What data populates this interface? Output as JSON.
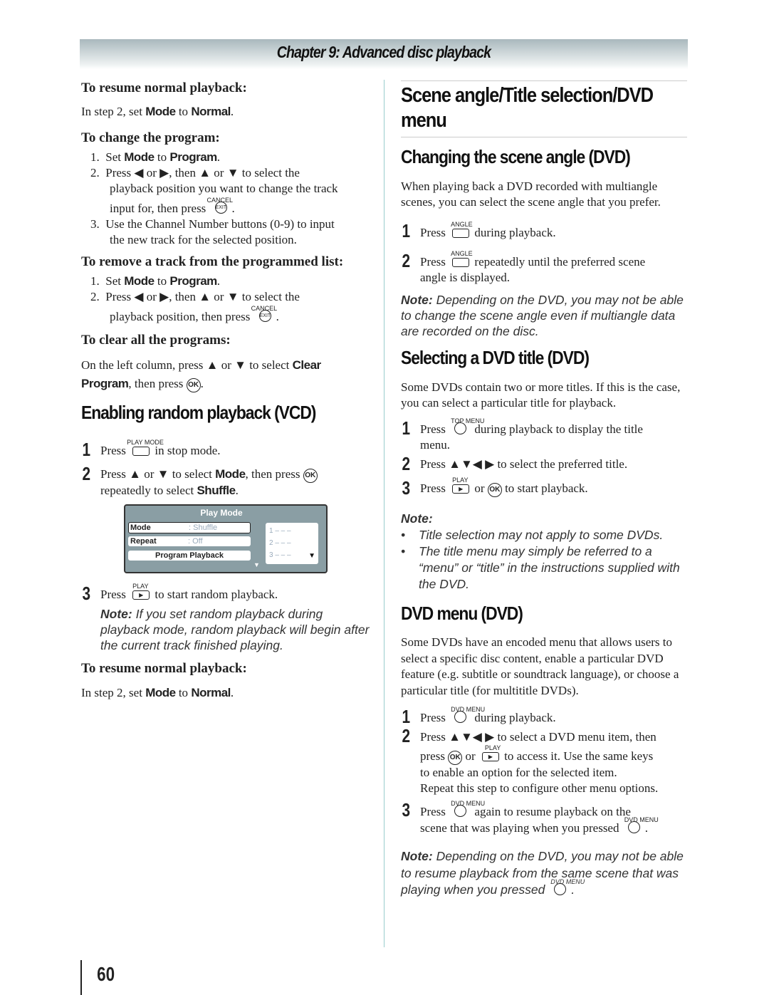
{
  "header": {
    "chapter": "Chapter 9: Advanced disc playback"
  },
  "left": {
    "resume1": {
      "title": "To resume normal playback:",
      "pre": "In step 2, set ",
      "mode": "Mode",
      "to": " to ",
      "normal": "Normal",
      "end": "."
    },
    "change": {
      "title": "To change the program:",
      "s1_pre": "Set ",
      "s1_mode": "Mode",
      "s1_to": " to ",
      "s1_prog": "Program",
      "s1_end": ".",
      "s2a": "Press ◀ or ▶, then ▲ or ▼ to select the",
      "s2b": "playback position you want to change the track",
      "s2c": "input for, then press",
      "s3a": "Use the Channel Number buttons (0-9) to input",
      "s3b": "the new track for the selected position."
    },
    "remove": {
      "title": "To remove a track from the programmed list:",
      "s1_pre": "Set ",
      "s1_mode": "Mode",
      "s1_to": " to ",
      "s1_prog": "Program",
      "s1_end": ".",
      "s2a": "Press ◀ or ▶, then ▲ or ▼ to select the",
      "s2b": "playback position, then press"
    },
    "clear": {
      "title": "To clear all the programs:",
      "a": "On the left column, press ▲ or ▼ to select ",
      "clear": "Clear",
      "prog": "Program",
      "b": ", then press"
    },
    "random": {
      "title": "Enabling random playback (VCD)",
      "step1_pre": "Press",
      "step1_post": "in stop mode.",
      "step2_pre": "Press ▲ or ▼ to select ",
      "mode": "Mode",
      "step2_mid": ", then press",
      "step2_b": "repeatedly to select ",
      "shuffle": "Shuffle",
      "step3_pre": "Press",
      "step3_post": "to start random playback.",
      "note_label": "Note:",
      "note": " If you set random playback during playback mode, random playback will begin after the current track finished playing."
    },
    "playmode": {
      "title": "Play Mode",
      "mode_label": "Mode",
      "mode_value": ": Shuffle",
      "repeat_label": "Repeat",
      "repeat_value": ": Off",
      "program_playback": "Program Playback",
      "list": [
        "1  – – –",
        "2  – – –",
        "3  – – –"
      ]
    },
    "resume2": {
      "title": "To resume normal playback:",
      "pre": "In step 2, set ",
      "mode": "Mode",
      "to": " to ",
      "normal": "Normal",
      "end": "."
    }
  },
  "right": {
    "title": "Scene angle/Title selection/DVD menu",
    "angle": {
      "title": "Changing the scene angle (DVD)",
      "intro": "When playing back a DVD recorded with multiangle scenes, you can select the scene angle that you prefer.",
      "s1_pre": "Press",
      "s1_post": "during playback.",
      "s2_pre": "Press",
      "s2_post": "repeatedly until the preferred scene",
      "s2_b": "angle is displayed.",
      "note_label": "Note:",
      "note": " Depending on the DVD, you may not be able to change the scene angle even if multiangle data are recorded on the disc."
    },
    "titlesel": {
      "title": "Selecting a DVD title (DVD)",
      "intro": "Some DVDs contain two or more titles. If this is the case, you can select a particular title for playback.",
      "s1_pre": "Press",
      "s1_post": "during playback to display the title",
      "s1_b": "menu.",
      "s2": "Press ▲▼◀ ▶ to select the preferred title.",
      "s3_pre": "Press",
      "s3_or": "or",
      "s3_post": "to start playback.",
      "note_label": "Note:",
      "bullets": [
        "Title selection may not apply to some DVDs.",
        "The title menu may simply be referred to a “menu” or “title” in the instructions supplied with the DVD."
      ]
    },
    "dvdmenu": {
      "title": "DVD menu (DVD)",
      "intro": "Some DVDs have an encoded menu that allows users to select a specific disc content, enable a particular DVD feature (e.g. subtitle or soundtrack language), or choose a particular title (for multititle DVDs).",
      "s1_pre": "Press",
      "s1_post": "during playback.",
      "s2a": "Press ▲▼◀ ▶ to select a DVD menu item, then",
      "s2b_pre": "press",
      "s2b_or": "or",
      "s2b_post": "to access it. Use the same keys",
      "s2c": "to enable an option for the selected item.",
      "s2d": "Repeat this step to configure other menu options.",
      "s3_pre": "Press",
      "s3_post": "again to resume playback on the",
      "s3_b": "scene that was playing when you pressed",
      "period": ".",
      "note_label": "Note:",
      "note": " Depending on the DVD, you may not be able to resume playback from the same scene that was playing when you pressed"
    }
  },
  "buttons": {
    "cancel": "CANCEL",
    "exit": "EXIT",
    "ok": "OK",
    "playmode": "PLAY MODE",
    "play": "PLAY",
    "play_glyph": "▶",
    "angle": "ANGLE",
    "topmenu": "TOP MENU",
    "dvdmenu": "DVD MENU"
  },
  "steps": [
    "1",
    "2",
    "3"
  ],
  "list_nums": [
    "1.",
    "2.",
    "3."
  ],
  "page_number": "60"
}
